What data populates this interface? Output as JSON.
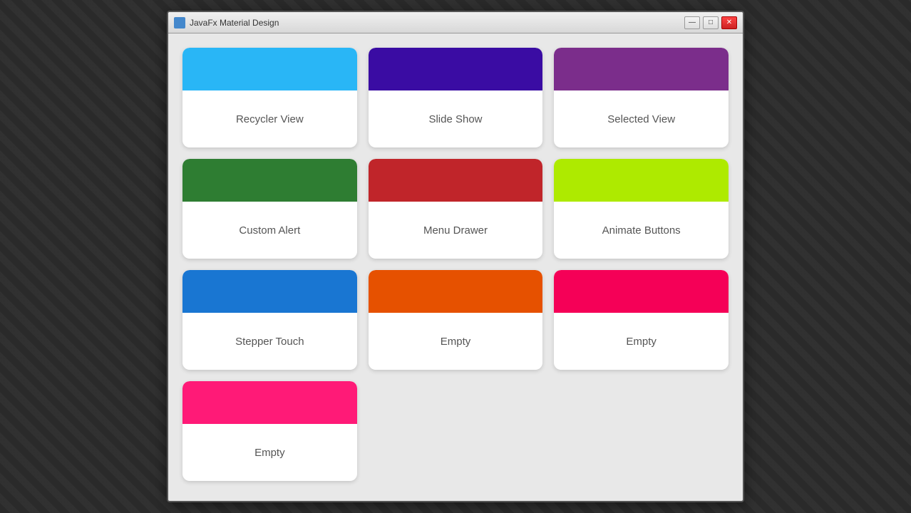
{
  "window": {
    "title": "JavaFx Material Design",
    "controls": {
      "minimize": "—",
      "maximize": "□",
      "close": "✕"
    }
  },
  "cards": [
    {
      "id": "recycler-view",
      "label": "Recycler View",
      "headerColor": "blue"
    },
    {
      "id": "slide-show",
      "label": "Slide Show",
      "headerColor": "indigo"
    },
    {
      "id": "selected-view",
      "label": "Selected View",
      "headerColor": "purple"
    },
    {
      "id": "custom-alert",
      "label": "Custom Alert",
      "headerColor": "green"
    },
    {
      "id": "menu-drawer",
      "label": "Menu Drawer",
      "headerColor": "red"
    },
    {
      "id": "animate-buttons",
      "label": "Animate Buttons",
      "headerColor": "lime"
    },
    {
      "id": "stepper-touch",
      "label": "Stepper Touch",
      "headerColor": "blue2"
    },
    {
      "id": "empty-1",
      "label": "Empty",
      "headerColor": "orange"
    },
    {
      "id": "empty-2",
      "label": "Empty",
      "headerColor": "pink"
    },
    {
      "id": "empty-3",
      "label": "Empty",
      "headerColor": "pink2"
    }
  ]
}
